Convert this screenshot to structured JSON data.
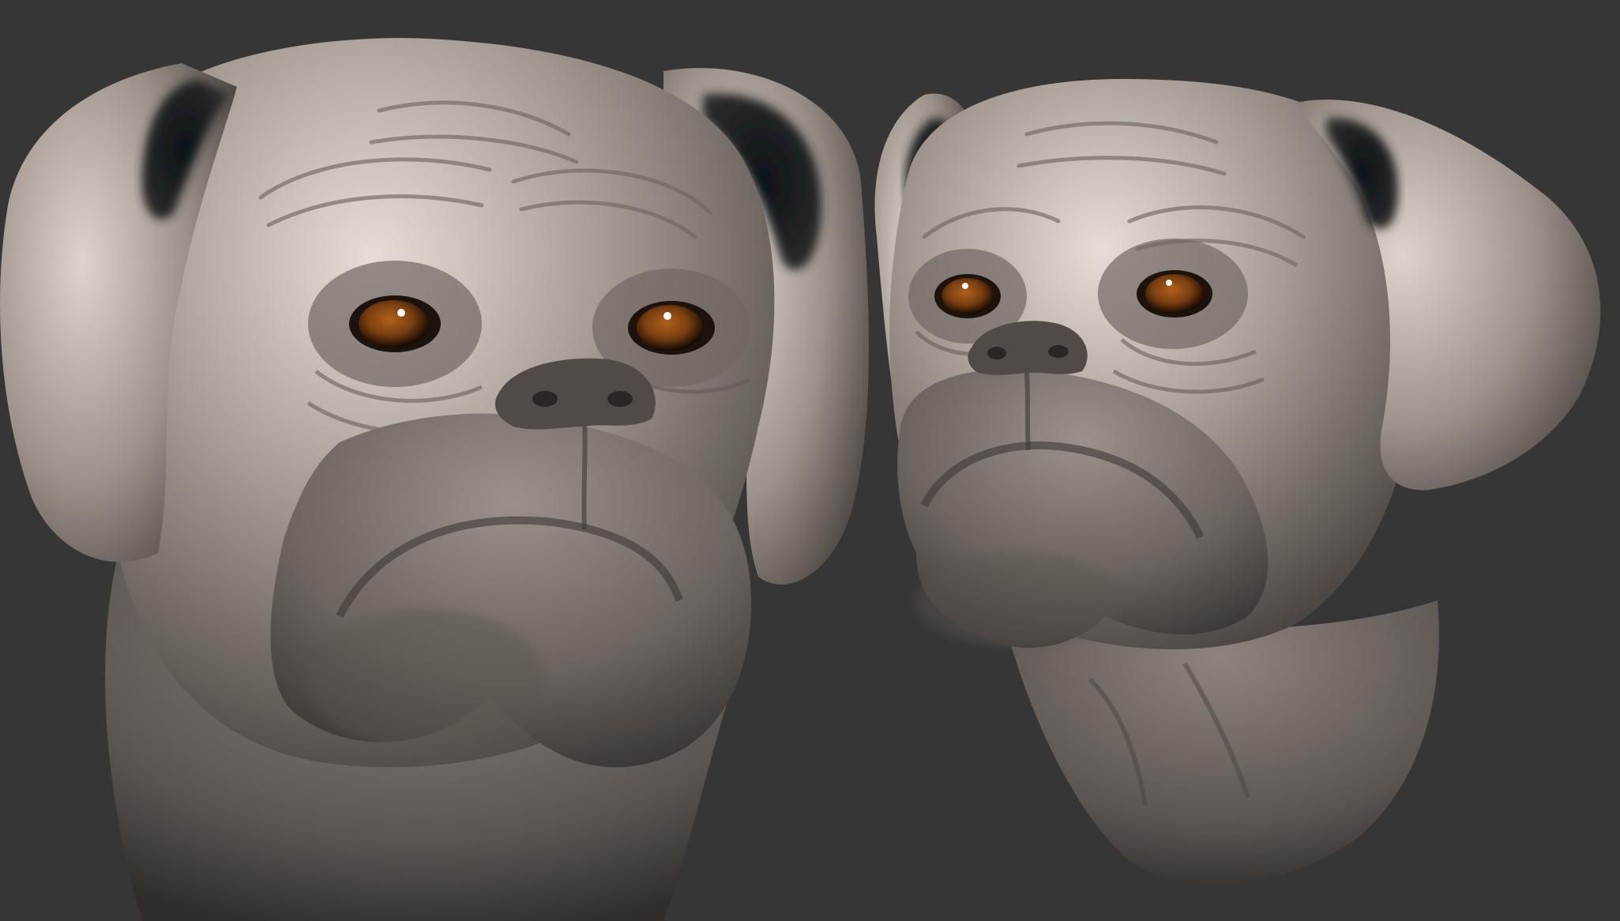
{
  "scene": {
    "background_color": "#363636",
    "clay_color": "#a79d95",
    "clay_highlight": "#e6ded6",
    "clay_shadow": "#3c3835",
    "eye_iris_color": "#7a3f0f",
    "eye_pupil_color": "#140a04",
    "objects": [
      {
        "name": "boxer-head-sculpt-front",
        "view": "front"
      },
      {
        "name": "boxer-head-sculpt-three-quarter",
        "view": "three-quarter"
      }
    ]
  }
}
